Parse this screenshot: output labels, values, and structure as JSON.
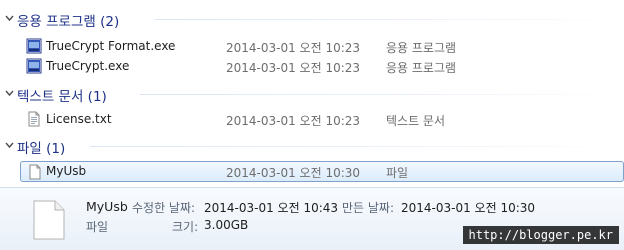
{
  "groups": {
    "apps": {
      "title": "응용 프로그램 (2)"
    },
    "text_docs": {
      "title": "텍스트 문서 (1)"
    },
    "files": {
      "title": "파일 (1)"
    }
  },
  "items": {
    "truecrypt_format": {
      "name": "TrueCrypt Format.exe",
      "date": "2014-03-01 오전 10:23",
      "type": "응용 프로그램",
      "icon": "exe-icon"
    },
    "truecrypt": {
      "name": "TrueCrypt.exe",
      "date": "2014-03-01 오전 10:23",
      "type": "응용 프로그램",
      "icon": "exe-icon"
    },
    "license": {
      "name": "License.txt",
      "date": "2014-03-01 오전 10:23",
      "type": "텍스트 문서",
      "icon": "text-file-icon"
    },
    "myusb": {
      "name": "MyUsb",
      "date": "2014-03-01 오전 10:30",
      "type": "파일",
      "icon": "blank-file-icon",
      "selected": true
    }
  },
  "details": {
    "name": "MyUsb",
    "modified_label": "수정한 날짜:",
    "modified_value": "2014-03-01 오전 10:43",
    "created_label": "만든 날짜:",
    "created_value": "2014-03-01 오전 10:30",
    "type": "파일",
    "size_label": "크기:",
    "size_value": "3.00GB"
  },
  "watermark": "http://blogger.pe.kr",
  "colors": {
    "group_title": "#1e3287",
    "selection_border": "#7da2ce",
    "meta_text": "#6d6d6d"
  }
}
